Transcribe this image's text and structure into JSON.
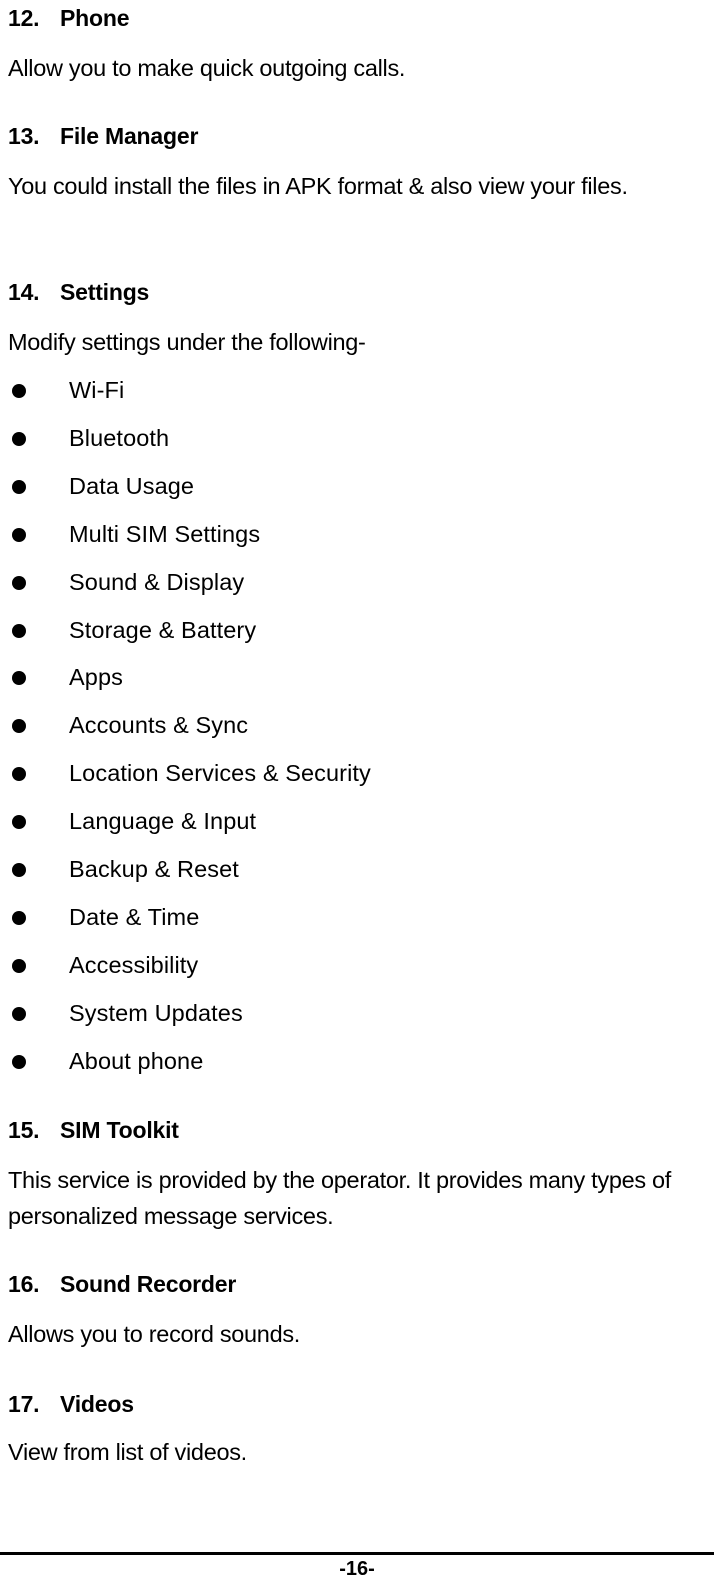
{
  "sections": [
    {
      "number": "12.",
      "title": "Phone",
      "body": "Allow you to make quick outgoing calls."
    },
    {
      "number": "13.",
      "title": "File Manager",
      "body": "You could install the files in APK format & also view your files."
    },
    {
      "number": "14.",
      "title": "Settings",
      "body": "Modify settings under the following-",
      "items": [
        "Wi-Fi",
        "Bluetooth",
        "Data Usage",
        "Multi SIM Settings",
        "Sound & Display",
        "Storage & Battery",
        "Apps",
        "Accounts & Sync",
        "Location Services & Security",
        "Language & Input",
        "Backup & Reset",
        "Date & Time",
        "Accessibility",
        "System Updates",
        "About phone"
      ]
    },
    {
      "number": "15.",
      "title": "SIM Toolkit",
      "body": "This service is provided by the operator. It provides many types of personalized message services."
    },
    {
      "number": "16.",
      "title": "Sound Recorder",
      "body": "Allows you to record sounds."
    },
    {
      "number": "17.",
      "title": "Videos",
      "body": "View from list of videos."
    }
  ],
  "footer": {
    "page_number": "-16-"
  }
}
